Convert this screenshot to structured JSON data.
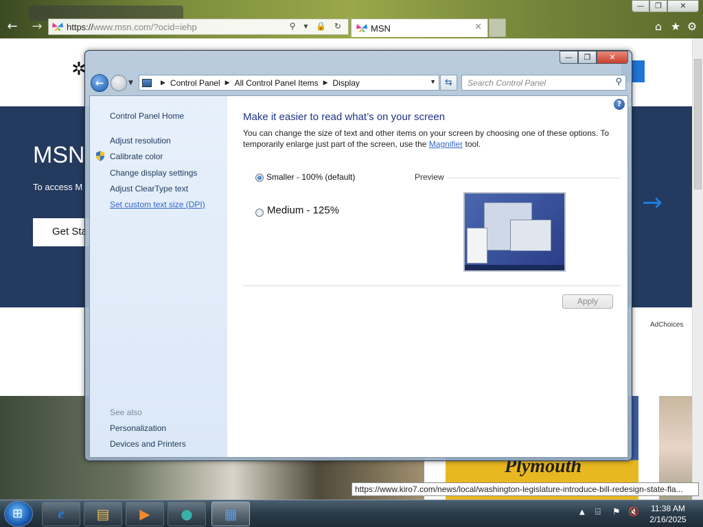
{
  "browser": {
    "address_prefix": "https://",
    "address_host": "www.msn.com",
    "address_path": "/?ocid=iehp",
    "tab_title": "MSN",
    "status_tooltip": "https://www.kiro7.com/news/local/washington-legislature-introduce-bill-redesign-state-fla..."
  },
  "msn": {
    "hero_title": "MSN",
    "hero_subtitle": "To access M",
    "hero_button": "Get Sta",
    "adchoices": "AdChoices",
    "promo_text": "Plymouth"
  },
  "control_panel": {
    "breadcrumb": [
      "Control Panel",
      "All Control Panel Items",
      "Display"
    ],
    "search_placeholder": "Search Control Panel",
    "sidebar": {
      "home": "Control Panel Home",
      "links": [
        "Adjust resolution",
        "Calibrate color",
        "Change display settings",
        "Adjust ClearType text",
        "Set custom text size (DPI)"
      ],
      "see_also_heading": "See also",
      "see_also": [
        "Personalization",
        "Devices and Printers"
      ]
    },
    "heading": "Make it easier to read what’s on your screen",
    "description_before": "You can change the size of text and other items on your screen by choosing one of these options. To temporarily enlarge just part of the screen, use the ",
    "magnifier_link": "Magnifier",
    "description_after": " tool.",
    "options": [
      {
        "label": "Smaller - 100% (default)",
        "selected": true
      },
      {
        "label": "Medium - 125%",
        "selected": false
      }
    ],
    "preview_label": "Preview",
    "apply_label": "Apply",
    "help_glyph": "?"
  },
  "taskbar": {
    "time": "11:38 AM",
    "date": "2/16/2025"
  },
  "colors": {
    "accent": "#1e3287",
    "link": "#3366cc",
    "msn_hero": "#243a5e"
  }
}
